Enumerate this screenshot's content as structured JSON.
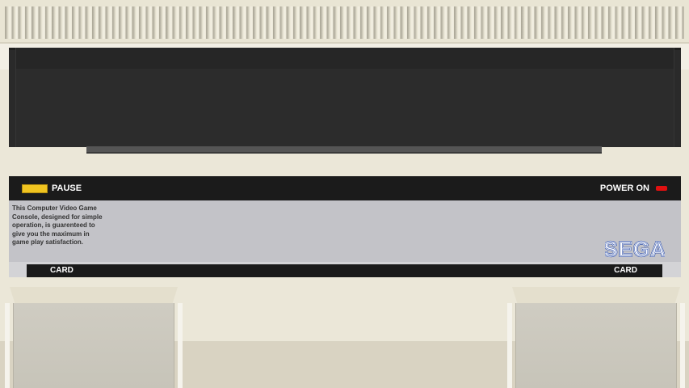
{
  "console": {
    "pause_label": "PAUSE",
    "power_label": "POWER ON",
    "info_text": "This Computer Video Game Console, designed for simple operation, is guarenteed to give you the maximum in game play satisfaction.",
    "brand": "SEGA",
    "card_left_label": "CARD",
    "card_right_label": "CARD"
  },
  "colors": {
    "body": "#ebe7d8",
    "slot": "#2a2a2a",
    "control_bar": "#1b1b1b",
    "info_panel": "#c3c3c8",
    "pause_button": "#f0c420",
    "power_led": "#e01010",
    "brand_blue": "#1b3fa0"
  },
  "icons": {
    "power_led": "power-led-icon",
    "vent": "vent-grille"
  }
}
